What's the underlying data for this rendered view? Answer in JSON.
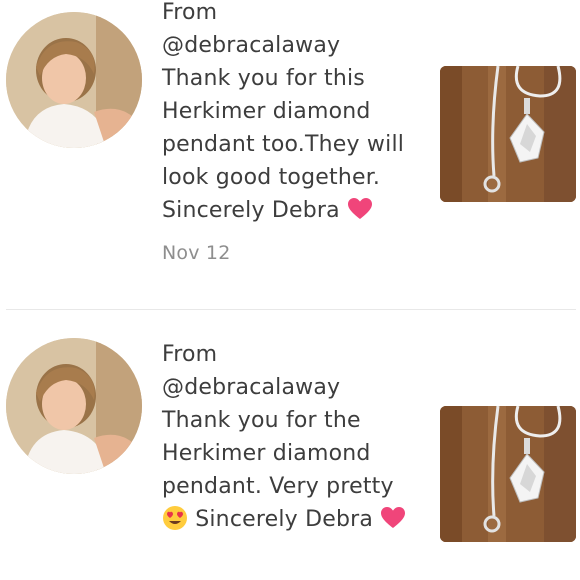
{
  "reviews": [
    {
      "from_label": "From",
      "handle": "@debracalaway",
      "message": "Thank you for this Herkimer diamond pendant too.They will look good together. Sincerely Debra",
      "date": "Nov 12",
      "avatar_icon": "profile-photo",
      "product_icon": "herkimer-pendant-photo"
    },
    {
      "from_label": "From",
      "handle": "@debracalaway",
      "message_part1": "Thank you for the Herkimer diamond pendant. Very pretty",
      "message_part2": "Sincerely Debra",
      "avatar_icon": "profile-photo",
      "product_icon": "herkimer-pendant-photo"
    }
  ],
  "colors": {
    "text": "#3d3d3d",
    "muted": "#8e8e8e",
    "heart": "#f0457a",
    "divider": "#e8e8e8"
  }
}
